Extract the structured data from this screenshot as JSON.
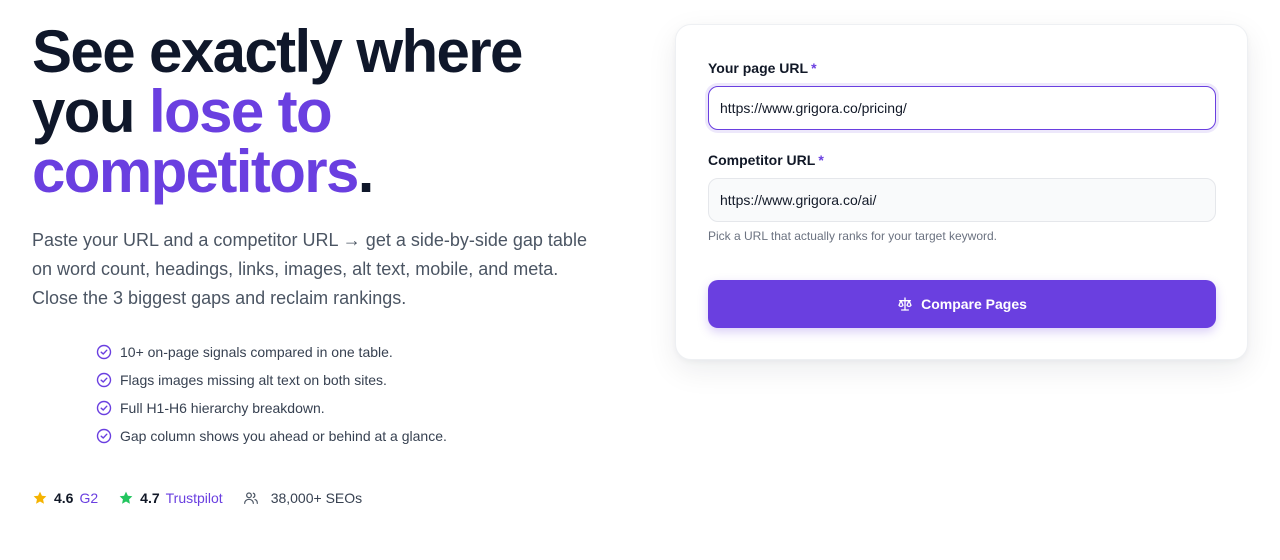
{
  "hero": {
    "headline_line1": "See exactly where",
    "headline_line2_plain": "you ",
    "headline_line2_accent": "lose to",
    "headline_line3_accent": "competitors",
    "headline_line3_end": ".",
    "subtitle": "Paste your URL and a competitor URL → get a side-by-side gap table on word count, headings, links, images, alt text, mobile, and meta. Close the 3 biggest gaps and reclaim rankings."
  },
  "features": [
    "10+ on-page signals compared in one table.",
    "Flags images missing alt text on both sites.",
    "Full H1-H6 hierarchy breakdown.",
    "Gap column shows you ahead or behind at a glance."
  ],
  "ratings": {
    "g2": {
      "score": "4.6",
      "source": "G2",
      "icon": "star-icon",
      "color": "#f5b301"
    },
    "trustpilot": {
      "score": "4.7",
      "source": "Trustpilot",
      "icon": "star-icon",
      "color": "#22c55e"
    },
    "users": {
      "text": "38,000+ SEOs",
      "icon": "users-icon"
    }
  },
  "form": {
    "page_url_label": "Your page URL",
    "page_url_value": "https://www.grigora.co/pricing/",
    "competitor_url_label": "Competitor URL",
    "competitor_url_value": "https://www.grigora.co/ai/",
    "required_mark": "*",
    "hint": "Pick a URL that actually ranks for your target keyword.",
    "submit_label": "Compare Pages",
    "submit_icon": "scale-icon"
  },
  "colors": {
    "accent": "#6a3fe0",
    "heading": "#0f172a",
    "body_text": "#4b5563"
  }
}
